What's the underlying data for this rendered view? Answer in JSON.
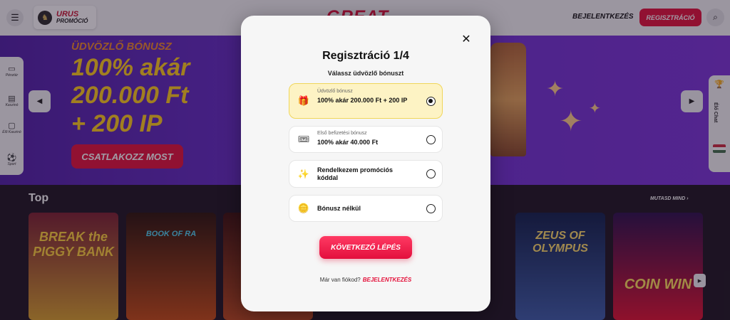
{
  "header": {
    "promo_line1": "URUS",
    "promo_line2": "PROMÓCIÓ",
    "brand": "GREAT",
    "login": "BEJELENTKEZÉS",
    "register": "REGISZTRÁCIÓ"
  },
  "hero": {
    "kicker": "ÜDVÖZLŐ BÓNUSZ",
    "line1": "100% akár",
    "line2": "200.000 Ft",
    "line3": "+ 200 IP",
    "cta": "CSATLAKOZZ MOST"
  },
  "sidebar": {
    "items": [
      {
        "label": "Pénztár",
        "icon": "wallet-icon"
      },
      {
        "label": "Kaszinó",
        "icon": "slot-icon"
      },
      {
        "label": "Élő Kaszinó",
        "icon": "cards-icon"
      },
      {
        "label": "Sport",
        "icon": "ball-icon"
      }
    ]
  },
  "right_rail": {
    "chat": "Élő Chat"
  },
  "games": {
    "title": "Top",
    "show_all": "MUTASD MIND",
    "cards": [
      {
        "name": "BREAK the PIGGY BANK",
        "color_top": "#7a1f2e",
        "color_bottom": "#d8a02a",
        "text_color": "#ffd23a"
      },
      {
        "name": "BOOK OF RA",
        "color_top": "#2a1208",
        "color_bottom": "#c44a12",
        "text_color": "#4fd3f0"
      },
      {
        "name": "",
        "color_top": "#3a0f0a",
        "color_bottom": "#b8461a",
        "text_color": "#ffd23a"
      },
      {
        "name": "ZEUS OF OLYMPUS",
        "color_top": "#0e1f4a",
        "color_bottom": "#3a5ca8",
        "text_color": "#ffdf6a"
      },
      {
        "name": "COIN WIN",
        "color_top": "#2a0f4a",
        "color_bottom": "#e0102f",
        "text_color": "#ffe05a"
      }
    ]
  },
  "modal": {
    "title": "Regisztráció 1/4",
    "subtitle": "Válassz üdvözlő bónuszt",
    "options": [
      {
        "small": "Üdvözlő bónusz",
        "main": "100% akár 200.000 Ft + 200 IP",
        "icon": "gift-icon",
        "selected": true
      },
      {
        "small": "Első befizetési bónusz",
        "main": "100% akár 40.000 Ft",
        "icon": "ticket-icon",
        "selected": false
      },
      {
        "small": "",
        "main": "Rendelkezem promóciós kóddal",
        "icon": "sparkle-icon",
        "selected": false
      },
      {
        "small": "",
        "main": "Bónusz nélkül",
        "icon": "coin-icon",
        "selected": false
      }
    ],
    "next": "KÖVETKEZŐ LÉPÉS",
    "footer_text": "Már van fiókod?",
    "footer_link": "BEJELENTKEZÉS"
  }
}
